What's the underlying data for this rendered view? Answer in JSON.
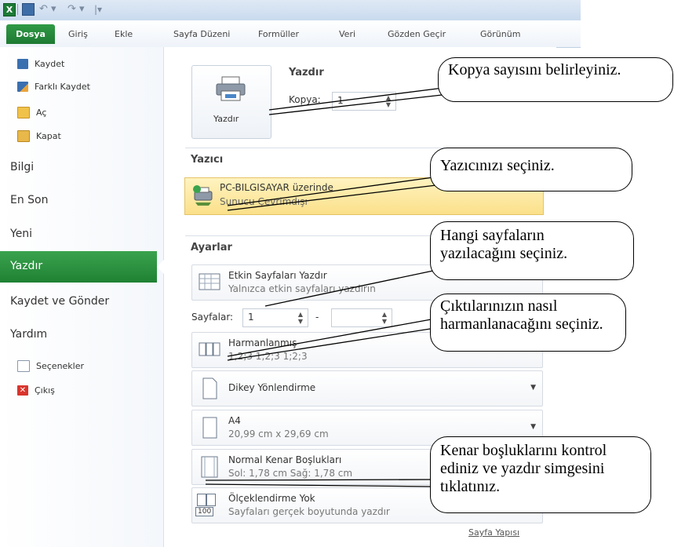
{
  "window": {
    "app_icon_text": "X",
    "quick_access": {
      "undo": "↶ ▾",
      "redo": "↷ ▾",
      "customize": "|▾"
    }
  },
  "ribbon": {
    "file_tab": "Dosya",
    "tabs": [
      "Giriş",
      "Ekle",
      "Sayfa Düzeni",
      "Formüller",
      "Veri",
      "Gözden Geçir",
      "Görünüm"
    ]
  },
  "nav": {
    "save": "Kaydet",
    "save_as": "Farklı Kaydet",
    "open": "Aç",
    "close": "Kapat",
    "info": "Bilgi",
    "recent": "En Son",
    "new": "Yeni",
    "print": "Yazdır",
    "save_send": "Kaydet ve Gönder",
    "help": "Yardım",
    "options": "Seçenekler",
    "exit": "Çıkış"
  },
  "print_section": {
    "title": "Yazdır",
    "button_label": "Yazdır",
    "copies_label": "Kopya:",
    "copies_value": "1"
  },
  "printer_section": {
    "title": "Yazıcı",
    "printer_name": "PC-BILGISAYAR üzerinde",
    "printer_status": "Sunucu Çevrimdışı"
  },
  "settings": {
    "title": "Ayarlar",
    "scope": {
      "line1": "Etkin Sayfaları Yazdır",
      "line2": "Yalnızca etkin sayfaları yazdırın"
    },
    "pages_label": "Sayfalar:",
    "pages_from": "1",
    "pages_dash": "-",
    "pages_to": "",
    "collate": {
      "line1": "Harmanlanmış",
      "line2": "1;2;3    1;2;3    1;2;3"
    },
    "orientation": {
      "line1": "Dikey Yönlendirme"
    },
    "paper": {
      "line1": "A4",
      "line2": "20,99 cm x 29,69 cm"
    },
    "margins": {
      "line1": "Normal Kenar Boşlukları",
      "line2": "Sol: 1,78 cm   Sağ: 1,78 cm"
    },
    "scaling": {
      "line1": "Ölçeklendirme Yok",
      "line2": "Sayfaları gerçek boyutunda yazdır",
      "icon_text": "100"
    },
    "page_setup_link": "Sayfa Yapısı"
  },
  "callouts": {
    "copies": "Kopya sayısını belirleyiniz.",
    "printer": "Yazıcınızı seçiniz.",
    "pages": "Hangi sayfaların yazılacağını seçiniz.",
    "collate": "Çıktılarınızın nasıl harmanlanacağını seçiniz.",
    "margins": "Kenar boşluklarını kontrol ediniz ve yazdır simgesini tıklatınız."
  },
  "colors": {
    "accent_green": "#1f8133",
    "printer_highlight": "#fbe08a"
  }
}
